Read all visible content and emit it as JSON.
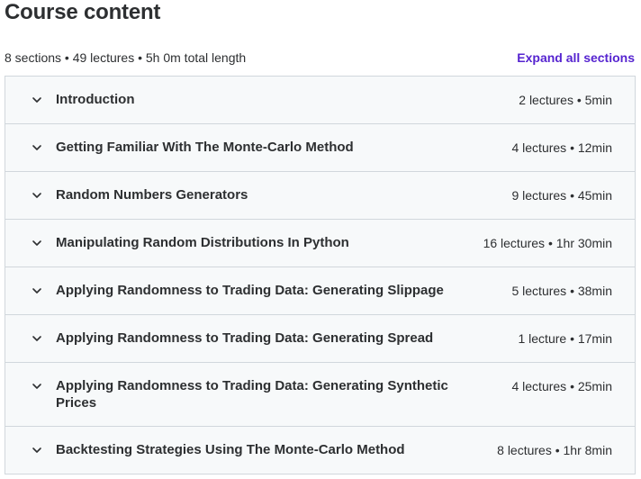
{
  "header": {
    "title": "Course content",
    "summary": "8 sections • 49 lectures • 5h 0m total length",
    "expand_label": "Expand all sections"
  },
  "sections": [
    {
      "title": "Introduction",
      "meta": "2 lectures • 5min"
    },
    {
      "title": "Getting Familiar With The Monte-Carlo Method",
      "meta": "4 lectures • 12min"
    },
    {
      "title": "Random Numbers Generators",
      "meta": "9 lectures • 45min"
    },
    {
      "title": "Manipulating Random Distributions In Python",
      "meta": "16 lectures • 1hr 30min"
    },
    {
      "title": "Applying Randomness to Trading Data: Generating Slippage",
      "meta": "5 lectures • 38min"
    },
    {
      "title": "Applying Randomness to Trading Data: Generating Spread",
      "meta": "1 lecture • 17min"
    },
    {
      "title": "Applying Randomness to Trading Data: Generating Synthetic Prices",
      "meta": "4 lectures • 25min"
    },
    {
      "title": "Backtesting Strategies Using The Monte-Carlo Method",
      "meta": "8 lectures • 1hr 8min"
    }
  ],
  "icons": {
    "section_toggle": "chevron-down-icon"
  },
  "colors": {
    "accent": "#5624d0",
    "text": "#2d2f31",
    "section_bg": "#f7f9fa",
    "border": "#d1d7dc"
  }
}
